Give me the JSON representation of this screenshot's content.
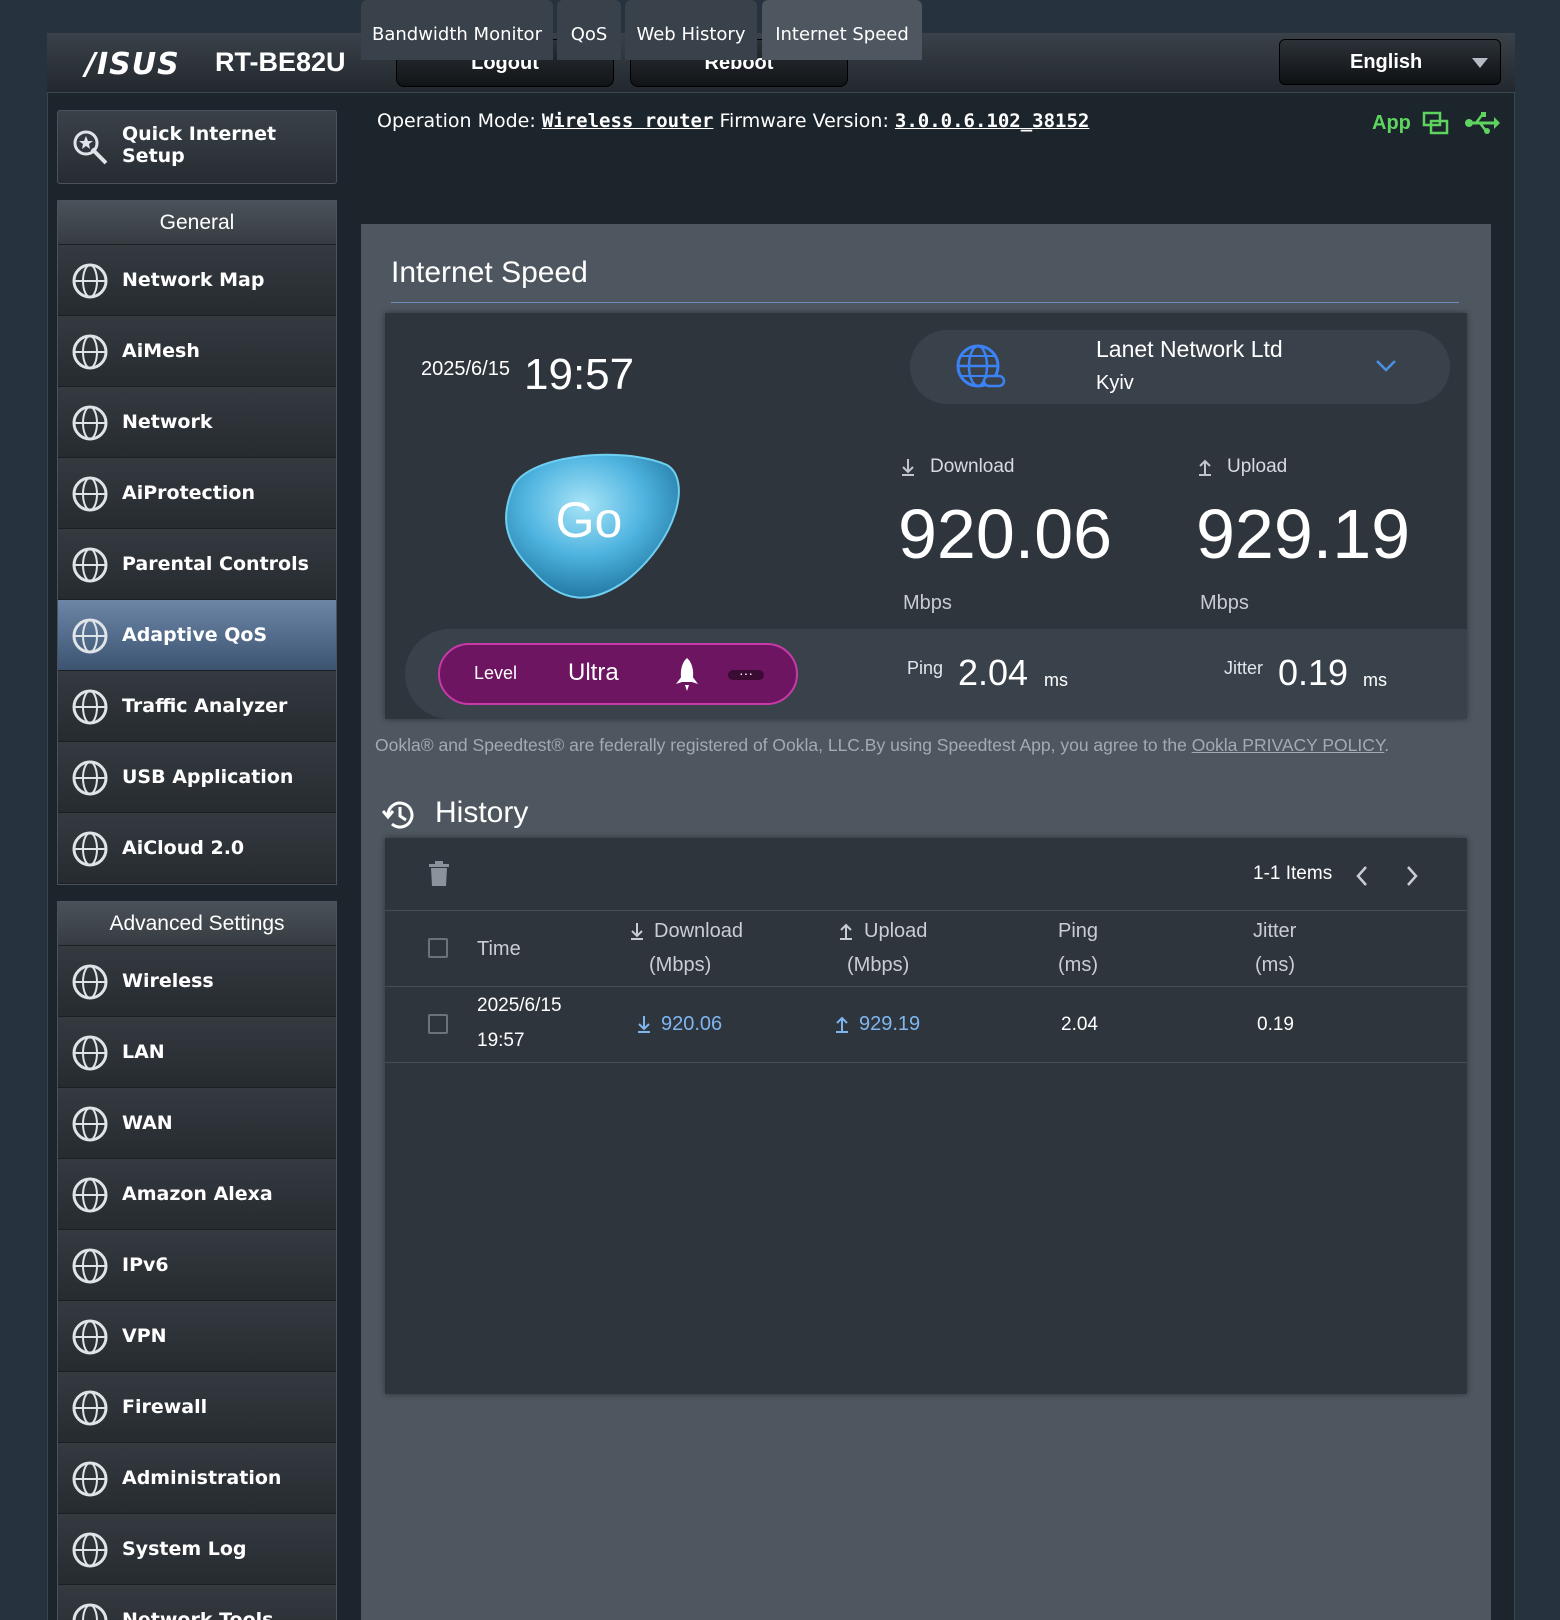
{
  "header": {
    "brand": "/ISUS",
    "model": "RT-BE82U",
    "logout_label": "Logout",
    "reboot_label": "Reboot",
    "language": "English"
  },
  "sidebar": {
    "quick_setup": "Quick Internet Setup",
    "general_title": "General",
    "general_items": [
      {
        "label": "Network Map",
        "icon": "network-map-icon"
      },
      {
        "label": "AiMesh",
        "icon": "aimesh-icon"
      },
      {
        "label": "Network",
        "icon": "network-icon"
      },
      {
        "label": "AiProtection",
        "icon": "aiprotection-icon"
      },
      {
        "label": "Parental Controls",
        "icon": "parental-controls-icon"
      },
      {
        "label": "Adaptive QoS",
        "icon": "adaptive-qos-icon",
        "active": true
      },
      {
        "label": "Traffic Analyzer",
        "icon": "traffic-analyzer-icon"
      },
      {
        "label": "USB Application",
        "icon": "usb-icon"
      },
      {
        "label": "AiCloud 2.0",
        "icon": "cloud-icon"
      }
    ],
    "advanced_title": "Advanced Settings",
    "advanced_items": [
      {
        "label": "Wireless",
        "icon": "wireless-icon"
      },
      {
        "label": "LAN",
        "icon": "lan-icon"
      },
      {
        "label": "WAN",
        "icon": "wan-icon"
      },
      {
        "label": "Amazon Alexa",
        "icon": "alexa-icon"
      },
      {
        "label": "IPv6",
        "icon": "ipv6-icon"
      },
      {
        "label": "VPN",
        "icon": "vpn-icon"
      },
      {
        "label": "Firewall",
        "icon": "firewall-icon"
      },
      {
        "label": "Administration",
        "icon": "administration-icon"
      },
      {
        "label": "System Log",
        "icon": "system-log-icon"
      },
      {
        "label": "Network Tools",
        "icon": "network-tools-icon"
      }
    ]
  },
  "status": {
    "op_mode_label": "Operation Mode:",
    "op_mode_value": "Wireless router",
    "fw_label": "Firmware Version:",
    "fw_value": "3.0.0.6.102_38152",
    "app_label": "App"
  },
  "tabs": [
    {
      "label": "Bandwidth Monitor"
    },
    {
      "label": "QoS"
    },
    {
      "label": "Web History"
    },
    {
      "label": "Internet Speed",
      "active": true
    }
  ],
  "speed": {
    "section_title": "Internet Speed",
    "date": "2025/6/15",
    "time": "19:57",
    "server_name": "Lanet Network Ltd",
    "server_city": "Kyiv",
    "go_label": "Go",
    "download_label": "Download",
    "download_value": "920.06",
    "download_unit": "Mbps",
    "upload_label": "Upload",
    "upload_value": "929.19",
    "upload_unit": "Mbps",
    "level_label": "Level",
    "level_value": "Ultra",
    "level_more": "···",
    "ping_label": "Ping",
    "ping_value": "2.04",
    "ping_unit": "ms",
    "jitter_label": "Jitter",
    "jitter_value": "0.19",
    "jitter_unit": "ms",
    "disclaimer": "Ookla® and Speedtest® are federally registered of Ookla, LLC.By using Speedtest App, you agree to the ",
    "privacy_link": "Ookla PRIVACY POLICY",
    "disclaimer_end": "."
  },
  "history": {
    "title": "History",
    "items_label": "1-1 Items",
    "columns": {
      "time": "Time",
      "download": "Download",
      "download_unit": "(Mbps)",
      "upload": "Upload",
      "upload_unit": "(Mbps)",
      "ping": "Ping",
      "ping_unit": "(ms)",
      "jitter": "Jitter",
      "jitter_unit": "(ms)"
    },
    "rows": [
      {
        "date": "2025/6/15",
        "time": "19:57",
        "download": "920.06",
        "upload": "929.19",
        "ping": "2.04",
        "jitter": "0.19"
      }
    ]
  },
  "colors": {
    "accent_link": "#7fb6f0",
    "app_green": "#5fd35f",
    "level_purple": "#6d1560",
    "go_blue": "#4fb4e0"
  }
}
